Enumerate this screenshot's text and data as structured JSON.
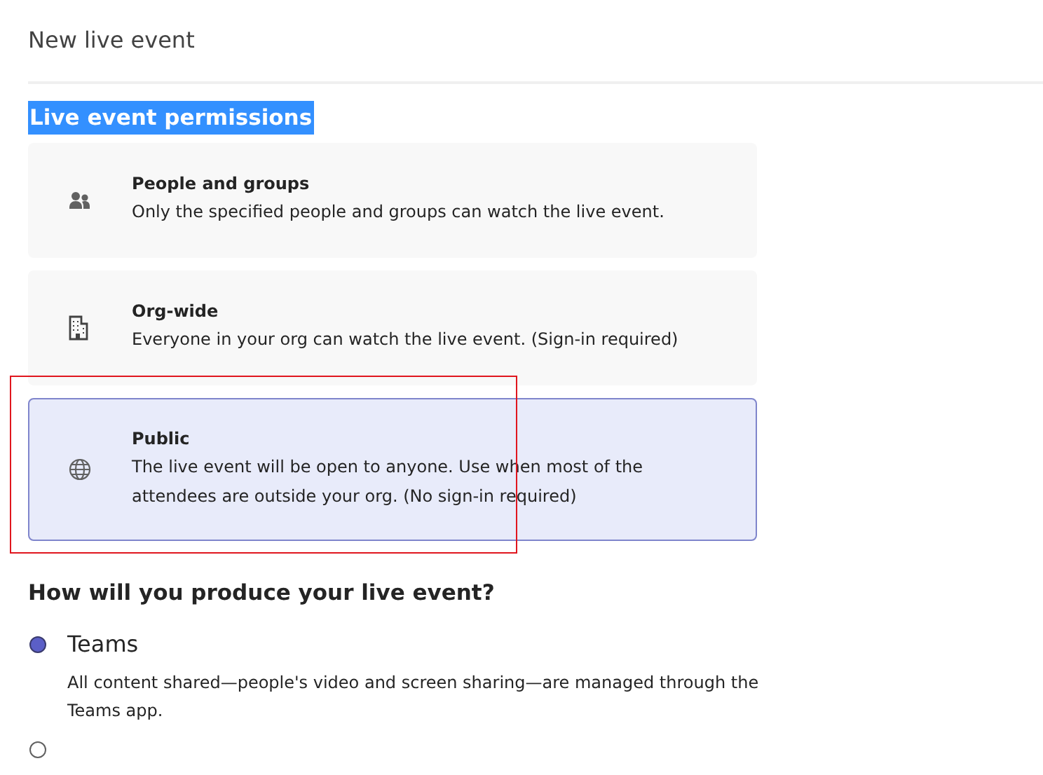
{
  "window": {
    "title": "New live event"
  },
  "permissions": {
    "heading": "Live event permissions",
    "heading_text_selected": true,
    "options": [
      {
        "kind": "people",
        "title": "People and groups",
        "description": "Only the specified people and groups can watch the live event.",
        "selected": false
      },
      {
        "kind": "building",
        "title": "Org-wide",
        "description": "Everyone in your org can watch the live event. (Sign-in required)",
        "selected": false
      },
      {
        "kind": "globe",
        "title": "Public",
        "description": "The live event will be open to anyone. Use when most of the attendees are outside your org. (No sign-in required)",
        "selected": true
      }
    ]
  },
  "annotation_box": true,
  "production": {
    "heading": "How will you produce your live event?",
    "options": [
      {
        "label": "Teams",
        "description": "All content shared—people's video and screen sharing—are managed through the Teams app.",
        "selected": true
      },
      {
        "selected": false
      }
    ]
  }
}
